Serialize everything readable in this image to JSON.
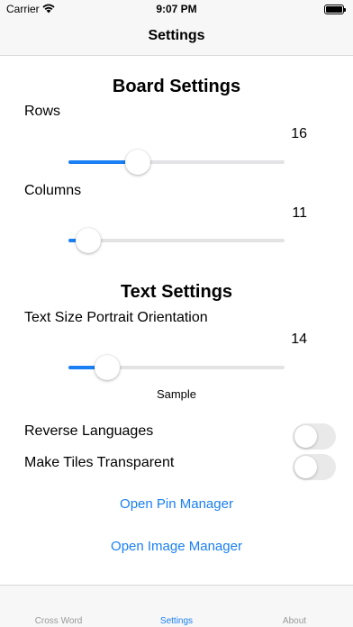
{
  "status_bar": {
    "carrier": "Carrier",
    "time": "9:07 PM"
  },
  "nav": {
    "title": "Settings"
  },
  "board_settings": {
    "title": "Board Settings",
    "rows": {
      "label": "Rows",
      "value": "16",
      "fraction": 0.32
    },
    "columns": {
      "label": "Columns",
      "value": "11",
      "fraction": 0.09
    }
  },
  "text_settings": {
    "title": "Text Settings",
    "text_size": {
      "label": "Text Size Portrait Orientation",
      "value": "14",
      "fraction": 0.18
    },
    "sample": "Sample"
  },
  "toggles": {
    "reverse_languages": {
      "label": "Reverse Languages",
      "on": false
    },
    "make_tiles_transparent": {
      "label": "Make Tiles Transparent",
      "on": false
    }
  },
  "links": {
    "pin_manager": "Open Pin Manager",
    "image_manager": "Open Image Manager"
  },
  "tabs": [
    {
      "label": "Cross Word",
      "active": false
    },
    {
      "label": "Settings",
      "active": true
    },
    {
      "label": "About",
      "active": false
    }
  ],
  "colors": {
    "accent": "#1a7ff5",
    "inactive_tab": "#999999",
    "track": "#e3e3e6"
  }
}
